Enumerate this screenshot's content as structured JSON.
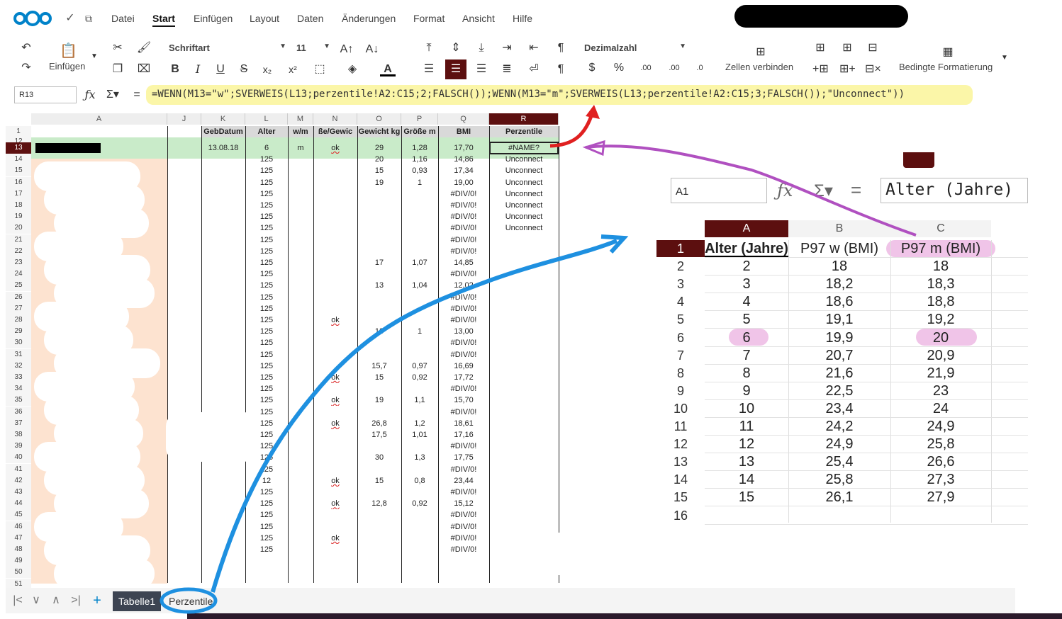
{
  "menu": {
    "items": [
      "Datei",
      "Start",
      "Einfügen",
      "Layout",
      "Daten",
      "Änderungen",
      "Format",
      "Ansicht",
      "Hilfe"
    ],
    "active": "Start"
  },
  "ribbon": {
    "paste_label": "Einfügen",
    "font_name": "Schriftart",
    "font_size": "11",
    "number_format": "Dezimalzahl",
    "merge_label": "Zellen verbinden",
    "conditional_label": "Bedingte Formatierung"
  },
  "formula_bar": {
    "cell_ref": "R13",
    "formula": "=WENN(M13=\"w\";SVERWEIS(L13;perzentile!A2:C15;2;FALSCH());WENN(M13=\"m\";SVERWEIS(L13;perzentile!A2:C15;3;FALSCH());\"Unconnect\"))"
  },
  "sheet": {
    "columns": [
      "A",
      "J",
      "K",
      "L",
      "M",
      "N",
      "O",
      "P",
      "Q",
      "R"
    ],
    "headers": {
      "K": "GebDatum",
      "L": "Alter",
      "M": "w/m",
      "N": "ße/Gewic",
      "O": "Gewicht kg",
      "P": "Größe m",
      "Q": "BMI",
      "R": "Perzentile"
    },
    "row_numbers": [
      "1",
      "12",
      "13",
      "14",
      "15",
      "16",
      "17",
      "18",
      "19",
      "20",
      "21",
      "22",
      "23",
      "24",
      "25",
      "26",
      "27",
      "28",
      "29",
      "30",
      "31",
      "32",
      "33",
      "34",
      "35",
      "36",
      "37",
      "38",
      "39",
      "40",
      "41",
      "42",
      "43",
      "44",
      "45",
      "46",
      "47",
      "48",
      "49",
      "50",
      "51"
    ],
    "rows": [
      {
        "r": "13",
        "K": "13.08.18",
        "L": "6",
        "M": "m",
        "N": "ok",
        "O": "29",
        "P": "1,28",
        "Q": "17,70",
        "R": "#NAME?"
      },
      {
        "r": "14",
        "L": "125",
        "O": "20",
        "P": "1,16",
        "Q": "14,86",
        "R": "Unconnect"
      },
      {
        "r": "15",
        "L": "125",
        "O": "15",
        "P": "0,93",
        "Q": "17,34",
        "R": "Unconnect"
      },
      {
        "r": "16",
        "L": "125",
        "O": "19",
        "P": "1",
        "Q": "19,00",
        "R": "Unconnect"
      },
      {
        "r": "17",
        "L": "125",
        "Q": "#DIV/0!",
        "R": "Unconnect"
      },
      {
        "r": "18",
        "L": "125",
        "Q": "#DIV/0!",
        "R": "Unconnect"
      },
      {
        "r": "19",
        "L": "125",
        "Q": "#DIV/0!",
        "R": "Unconnect"
      },
      {
        "r": "20",
        "L": "125",
        "Q": "#DIV/0!",
        "R": "Unconnect"
      },
      {
        "r": "21",
        "L": "125",
        "Q": "#DIV/0!"
      },
      {
        "r": "22",
        "L": "125",
        "Q": "#DIV/0!"
      },
      {
        "r": "23",
        "L": "125",
        "O": "17",
        "P": "1,07",
        "Q": "14,85"
      },
      {
        "r": "24",
        "L": "125",
        "Q": "#DIV/0!"
      },
      {
        "r": "25",
        "L": "125",
        "O": "13",
        "P": "1,04",
        "Q": "12,02"
      },
      {
        "r": "26",
        "L": "125",
        "Q": "#DIV/0!"
      },
      {
        "r": "27",
        "L": "125",
        "Q": "#DIV/0!"
      },
      {
        "r": "28",
        "L": "125",
        "N": "ok",
        "Q": "#DIV/0!"
      },
      {
        "r": "29",
        "L": "125",
        "O": "13",
        "P": "1",
        "Q": "13,00"
      },
      {
        "r": "30",
        "L": "125",
        "Q": "#DIV/0!"
      },
      {
        "r": "31",
        "L": "125",
        "Q": "#DIV/0!"
      },
      {
        "r": "32",
        "L": "125",
        "O": "15,7",
        "P": "0,97",
        "Q": "16,69"
      },
      {
        "r": "33",
        "L": "125",
        "N": "ok",
        "O": "15",
        "P": "0,92",
        "Q": "17,72"
      },
      {
        "r": "34",
        "L": "125",
        "Q": "#DIV/0!"
      },
      {
        "r": "35",
        "L": "125",
        "N": "ok",
        "O": "19",
        "P": "1,1",
        "Q": "15,70"
      },
      {
        "r": "36",
        "L": "125",
        "Q": "#DIV/0!"
      },
      {
        "r": "37",
        "L": "125",
        "N": "ok",
        "O": "26,8",
        "P": "1,2",
        "Q": "18,61"
      },
      {
        "r": "38",
        "L": "125",
        "O": "17,5",
        "P": "1,01",
        "Q": "17,16"
      },
      {
        "r": "39",
        "L": "125",
        "Q": "#DIV/0!"
      },
      {
        "r": "40",
        "L": "125",
        "O": "30",
        "P": "1,3",
        "Q": "17,75"
      },
      {
        "r": "41",
        "L": "125",
        "Q": "#DIV/0!"
      },
      {
        "r": "42",
        "L": "12",
        "N": "ok",
        "O": "15",
        "P": "0,8",
        "Q": "23,44"
      },
      {
        "r": "43",
        "L": "125",
        "Q": "#DIV/0!"
      },
      {
        "r": "44",
        "L": "125",
        "N": "ok",
        "O": "12,8",
        "P": "0,92",
        "Q": "15,12"
      },
      {
        "r": "45",
        "L": "125",
        "Q": "#DIV/0!"
      },
      {
        "r": "46",
        "L": "125",
        "Q": "#DIV/0!"
      },
      {
        "r": "47",
        "L": "125",
        "N": "ok",
        "Q": "#DIV/0!"
      },
      {
        "r": "48",
        "L": "125",
        "Q": "#DIV/0!"
      }
    ]
  },
  "tabs": [
    "Tabelle1",
    "Perzentile"
  ],
  "inset": {
    "cell_ref": "A1",
    "formula": "Alter (Jahre)",
    "columns": [
      "A",
      "B",
      "C"
    ],
    "headers": [
      "Alter (Jahre)",
      "P97 w (BMI)",
      "P97 m (BMI)"
    ],
    "row_numbers": [
      "1",
      "2",
      "3",
      "4",
      "5",
      "6",
      "7",
      "8",
      "9",
      "10",
      "11",
      "12",
      "13",
      "14",
      "15",
      "16"
    ],
    "rows": [
      [
        "2",
        "18",
        "18"
      ],
      [
        "3",
        "18,2",
        "18,3"
      ],
      [
        "4",
        "18,6",
        "18,8"
      ],
      [
        "5",
        "19,1",
        "19,2"
      ],
      [
        "6",
        "19,9",
        "20"
      ],
      [
        "7",
        "20,7",
        "20,9"
      ],
      [
        "8",
        "21,6",
        "21,9"
      ],
      [
        "9",
        "22,5",
        "23"
      ],
      [
        "10",
        "23,4",
        "24"
      ],
      [
        "11",
        "24,2",
        "24,9"
      ],
      [
        "12",
        "24,9",
        "25,8"
      ],
      [
        "13",
        "25,4",
        "26,6"
      ],
      [
        "14",
        "25,8",
        "27,3"
      ],
      [
        "15",
        "26,1",
        "27,9"
      ]
    ]
  },
  "colors": {
    "accent": "#0082c9",
    "selected": "#5c0f0f",
    "highlight_row": "#b7e4b7",
    "formula_bg": "#fbf6a8",
    "annotation_red": "#e02020",
    "annotation_purple": "#b050c0",
    "annotation_blue": "#1e90e0"
  }
}
